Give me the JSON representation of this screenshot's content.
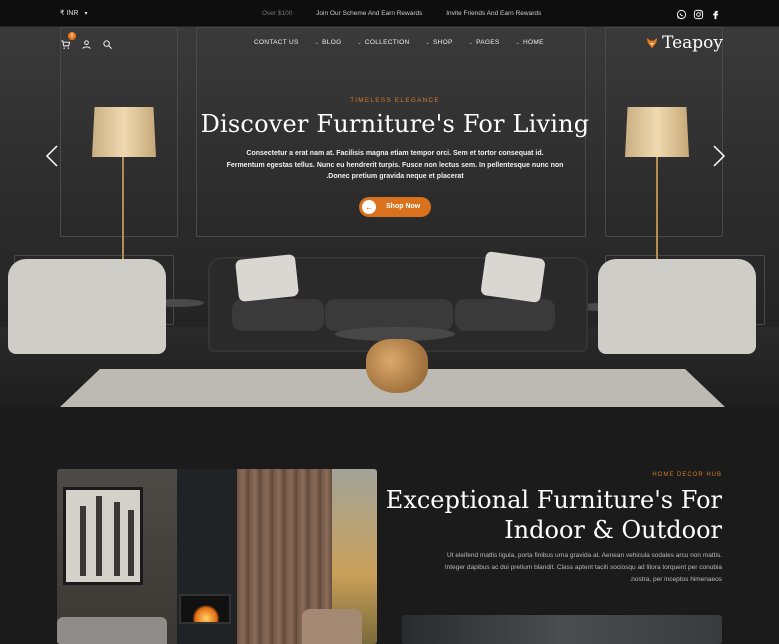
{
  "topbar": {
    "currency": "₹ INR",
    "marquee": [
      "Over $100",
      "Join Our Scheme And Earn Rewards",
      "Invite Friends And Earn Rewards"
    ],
    "social_icons": [
      "whatsapp-icon",
      "instagram-icon",
      "facebook-icon"
    ]
  },
  "nav": {
    "cart_count": "0",
    "menu": [
      {
        "label": "CONTACT US",
        "has_caret": false
      },
      {
        "label": "BLOG",
        "has_caret": true
      },
      {
        "label": "COLLECTION",
        "has_caret": true
      },
      {
        "label": "SHOP",
        "has_caret": true
      },
      {
        "label": "PAGES",
        "has_caret": true
      },
      {
        "label": "HOME",
        "has_caret": true
      }
    ],
    "logo": "Teapoy"
  },
  "hero": {
    "eyebrow": "TIMELESS ELEGANCE",
    "title": "Discover Furniture's For Living",
    "desc_line1": "Consectetur a erat nam at. Facilisis magna etiam tempor orci. Sem et tortor consequat id.",
    "desc_line2": "Fermentum egestas tellus. Nunc eu hendrerit turpis. Fusce non lectus sem. In pellentesque nunc non",
    "desc_line3": ".Donec pretium gravida neque et placerat",
    "button": "Shop Now"
  },
  "section": {
    "eyebrow": "HOME DECOR HUB",
    "title_line1": "Exceptional Furniture's For",
    "title_line2": "Indoor & Outdoor",
    "desc_line1": "Ut eleifend mattis ligula, porta finibus urna gravida at. Aenean vehicula sodales arcu non mattis.",
    "desc_line2": "Integer dapibus ac dui pretium blandit. Class aptent taciti sociosqu ad litora torquent per conubia",
    "desc_line3": ".nostra, per inceptos himenaeos"
  },
  "colors": {
    "accent": "#d9711d",
    "eyebrow": "#d67a2a",
    "topbar_bg": "#0e0e0e",
    "page_bg": "#1b1b1b"
  }
}
